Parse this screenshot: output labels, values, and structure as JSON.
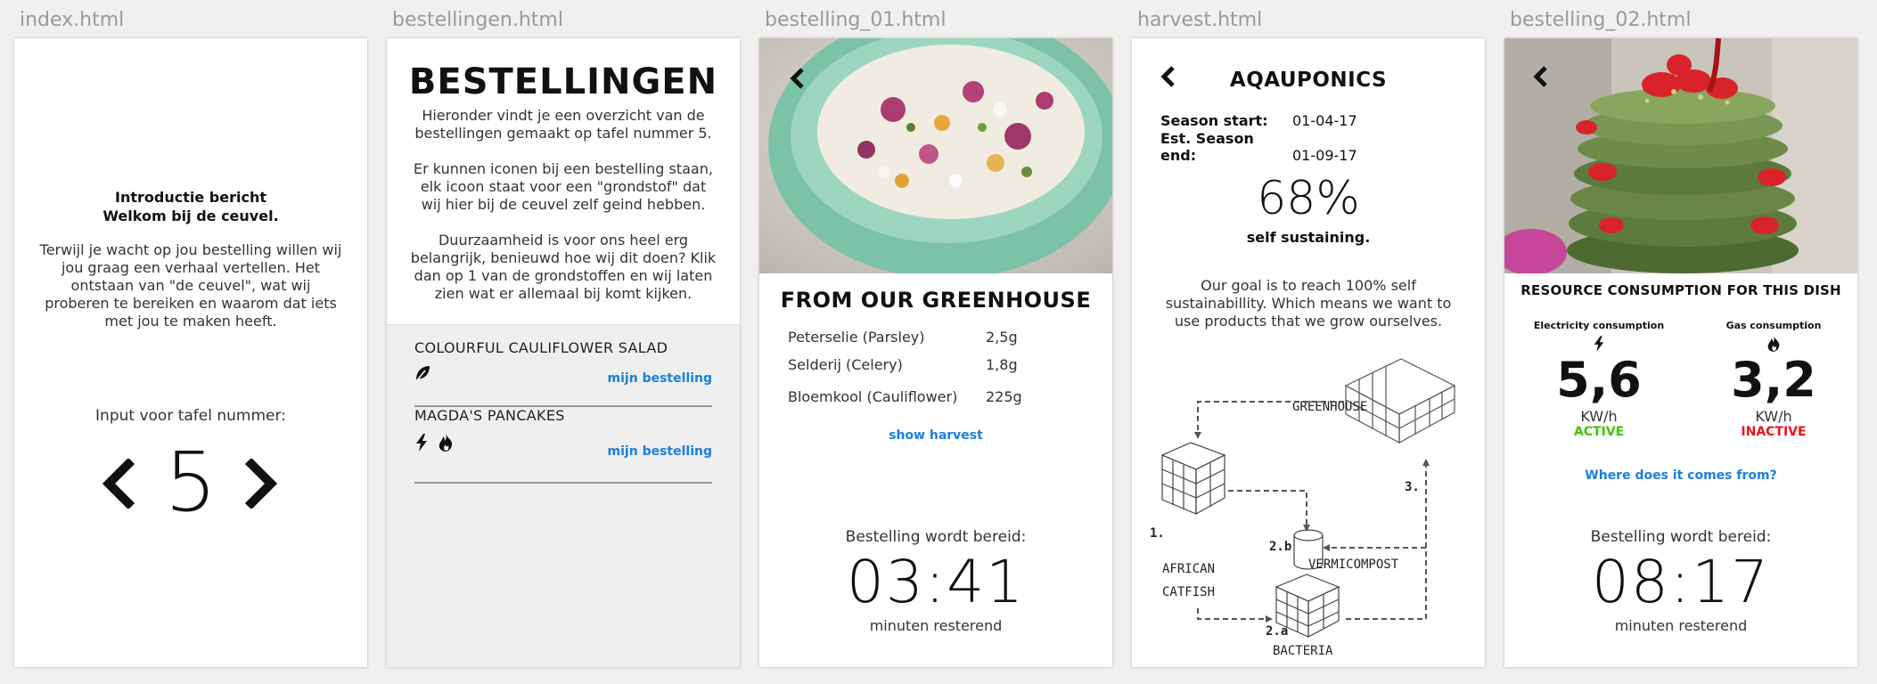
{
  "screens": {
    "index": {
      "file_label": "index.html",
      "intro_title_1": "Introductie bericht",
      "intro_title_2": "Welkom bij de ceuvel.",
      "intro_body": "Terwijl je wacht op jou bestelling willen wij jou graag een verhaal vertellen. Het ontstaan van \"de ceuvel\", wat wij proberen te bereiken en waarom dat iets met jou te maken heeft.",
      "input_label": "Input voor tafel nummer:",
      "table_number": "5"
    },
    "bestellingen": {
      "file_label": "bestellingen.html",
      "title": "BESTELLINGEN",
      "para_1": "Hieronder vindt je een overzicht van de bestellingen gemaakt op tafel nummer 5.",
      "para_2": "Er kunnen iconen bij een bestelling staan, elk icoon staat voor een \"grondstof\" dat wij hier bij de ceuvel zelf geind hebben.",
      "para_3": "Duurzaamheid is voor ons heel erg belangrijk, benieuwd hoe wij dit doen? Klik dan op 1 van de grondstoffen en wij laten zien wat er allemaal bij komt kijken.",
      "orders": [
        {
          "name": "COLOURFUL CAULIFLOWER SALAD",
          "link": "mijn bestelling",
          "icons": [
            "leaf-icon"
          ]
        },
        {
          "name": "MAGDA'S PANCAKES",
          "link": "mijn bestelling",
          "icons": [
            "lightning-icon",
            "flame-icon"
          ]
        }
      ]
    },
    "bestelling_01": {
      "file_label": "bestelling_01.html",
      "heading": "FROM OUR GREENHOUSE",
      "ingredients": [
        {
          "name": "Peterselie (Parsley)",
          "amount": "2,5g"
        },
        {
          "name": "Selderij (Celery)",
          "amount": "1,8g"
        },
        {
          "name": "Bloemkool (Cauliflower)",
          "amount": "225g"
        }
      ],
      "link": "show harvest",
      "prep_label": "Bestelling wordt bereid:",
      "timer": "03:41",
      "remaining": "minuten resterend"
    },
    "harvest": {
      "file_label": "harvest.html",
      "heading": "AQAUPONICS",
      "season_start_label": "Season start:",
      "season_start": "01-04-17",
      "season_end_label": "Est. Season end:",
      "season_end": "01-09-17",
      "percent": "68%",
      "percent_label": "self sustaining.",
      "goal": "Our goal is to reach 100% self sustainabillity. Which means we want to use products that we grow ourselves.",
      "diagram": {
        "greenhouse": "GREENHOUSE",
        "step_3": "3.",
        "step_1": "1.",
        "african": "AFRICAN",
        "catfish": "CATFISH",
        "step_2b": "2.b",
        "vermicompost": "VERMICOMPOST",
        "step_2a": "2.a",
        "bacteria": "BACTERIA"
      }
    },
    "bestelling_02": {
      "file_label": "bestelling_02.html",
      "heading": "RESOURCE CONSUMPTION FOR THIS DISH",
      "resources": [
        {
          "label": "Electricity consumption",
          "value": "5,6",
          "unit": "KW/h",
          "status": "ACTIVE",
          "status_color": "#3cc800"
        },
        {
          "label": "Gas consumption",
          "value": "3,2",
          "unit": "KW/h",
          "status": "INACTIVE",
          "status_color": "#e8141e"
        }
      ],
      "link": "Where does it comes from?",
      "prep_label": "Bestelling wordt bereid:",
      "timer": "08:17",
      "remaining": "minuten resterend"
    }
  },
  "colors": {
    "link_blue": "#1a7fe0",
    "active_green": "#3cc800",
    "inactive_red": "#e8141e"
  }
}
